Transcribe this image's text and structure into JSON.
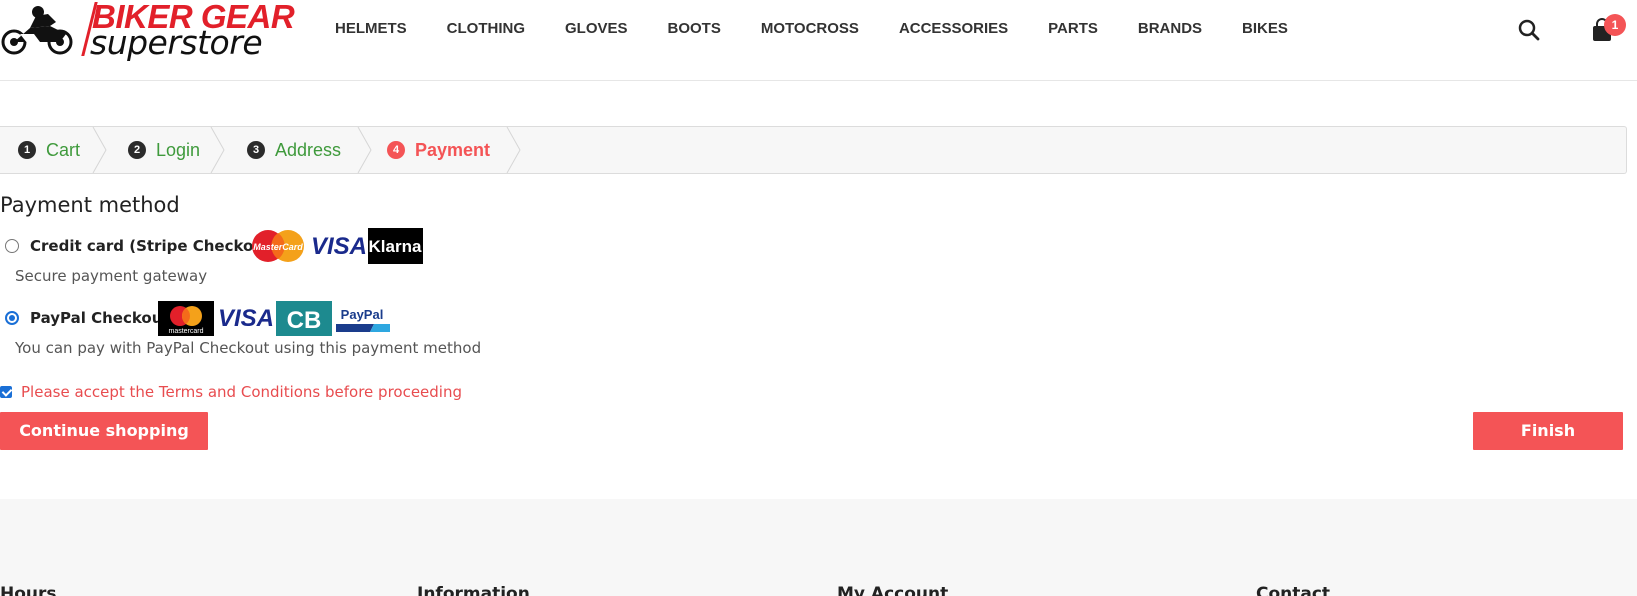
{
  "brand": {
    "line1": "BIKER GEAR",
    "line2": "superstore"
  },
  "nav": {
    "items": [
      "HELMETS",
      "CLOTHING",
      "GLOVES",
      "BOOTS",
      "MOTOCROSS",
      "ACCESSORIES",
      "PARTS",
      "BRANDS",
      "BIKES"
    ]
  },
  "header": {
    "cart_count": "1",
    "search_icon": "search-icon",
    "cart_icon": "shopping-bag-icon"
  },
  "steps": [
    {
      "num": "1",
      "label": "Cart",
      "state": "done"
    },
    {
      "num": "2",
      "label": "Login",
      "state": "done"
    },
    {
      "num": "3",
      "label": "Address",
      "state": "done"
    },
    {
      "num": "4",
      "label": "Payment",
      "state": "active"
    }
  ],
  "payment": {
    "title": "Payment method",
    "options": [
      {
        "label": "Credit card (Stripe Checkout)",
        "description": "Secure payment gateway",
        "selected": false,
        "logos": [
          "MasterCard",
          "VISA",
          "Klarna"
        ]
      },
      {
        "label": "PayPal Checkout",
        "description": "You can pay with PayPal Checkout using this payment method",
        "selected": true,
        "logos": [
          "mastercard",
          "VISA",
          "CB",
          "PayPal"
        ]
      }
    ],
    "terms": {
      "checked": true,
      "text": "Please accept the Terms and Conditions before proceeding"
    }
  },
  "buttons": {
    "continue": "Continue shopping",
    "finish": "Finish"
  },
  "footer": {
    "headings": [
      "Hours",
      "Information",
      "My Account",
      "Contact"
    ]
  },
  "colors": {
    "accent": "#f45456",
    "step_done": "#3f9a3c",
    "brand_red": "#e2202a",
    "link_blue": "#1a6fd6"
  }
}
